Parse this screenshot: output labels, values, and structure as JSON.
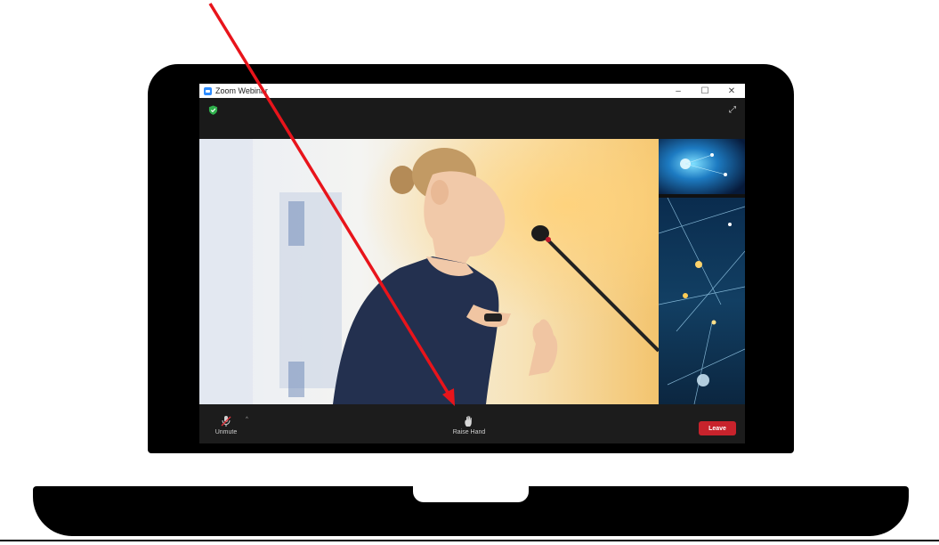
{
  "window": {
    "title": "Zoom Webinar",
    "controls": {
      "minimize": "–",
      "maximize": "☐",
      "close": "✕"
    }
  },
  "topbar": {
    "security_icon": "shield-check-icon",
    "fullscreen_icon": "expand-icon"
  },
  "toolbar": {
    "unmute_label": "Unmute",
    "unmute_caret": "^",
    "raise_hand_label": "Raise Hand",
    "leave_label": "Leave"
  },
  "colors": {
    "accent": "#2d8cff",
    "leave": "#c8232c",
    "secure": "#2fb14c",
    "annotation_arrow": "#e8141b"
  }
}
